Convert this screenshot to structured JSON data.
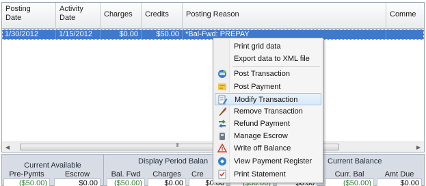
{
  "grid": {
    "columns": [
      {
        "label": "Posting\nDate"
      },
      {
        "label": "Activity\nDate"
      },
      {
        "label": "Charges"
      },
      {
        "label": "Credits"
      },
      {
        "label": "Posting Reason"
      },
      {
        "label": "Comme"
      }
    ],
    "rows": [
      {
        "posting_date": "1/30/2012",
        "activity_date": "1/15/2012",
        "charges": "$0.00",
        "credits": "$50.00",
        "posting_reason": "*Bal-Fwd: PREPAY"
      }
    ]
  },
  "scrollbar": {
    "grip": "III"
  },
  "context_menu": {
    "items": [
      {
        "label": "Print grid data",
        "icon": ""
      },
      {
        "label": "Export data to XML file",
        "icon": ""
      },
      {
        "label": "Post Transaction",
        "icon": "post-transaction-icon"
      },
      {
        "label": "Post Payment",
        "icon": "post-payment-icon"
      },
      {
        "label": "Modify Transaction",
        "icon": "modify-transaction-icon",
        "highlighted": true
      },
      {
        "label": "Remove Transaction",
        "icon": "remove-transaction-icon"
      },
      {
        "label": "Refund Payment",
        "icon": "refund-payment-icon"
      },
      {
        "label": "Manage Escrow",
        "icon": "manage-escrow-icon"
      },
      {
        "label": "Write off Balance",
        "icon": "write-off-icon"
      },
      {
        "label": "View Payment Register",
        "icon": "payment-register-icon"
      },
      {
        "label": "Print Statement",
        "icon": "print-statement-icon"
      }
    ]
  },
  "balances": {
    "current_available": {
      "title": "Current Available",
      "pre_pymts_label": "Pre-Pymts",
      "pre_pymts_value": "($50.00)",
      "escrow_label": "Escrow",
      "escrow_value": "$0.00"
    },
    "display_period": {
      "title": "Display Period Balan",
      "bal_fwd_label": "Bal. Fwd",
      "bal_fwd_value": "($50.00)",
      "charges_label": "Charges",
      "charges_value": "$0.00",
      "credits_label": "Cre",
      "hidden_values": [
        "$0.00",
        "($50.00)",
        "$0.00"
      ]
    },
    "current_balance": {
      "title": "Current Balance",
      "curr_bal_label": "Curr. Bal",
      "curr_bal_value": "($50.00)",
      "amt_due_label": "Amt Due",
      "amt_due_value": "$0.00"
    }
  },
  "colors": {
    "selection": "#3f79cc",
    "menu_highlight": "#d8e8f8",
    "negative_amount": "#2a7a2a",
    "panel": "#d8dde5"
  }
}
